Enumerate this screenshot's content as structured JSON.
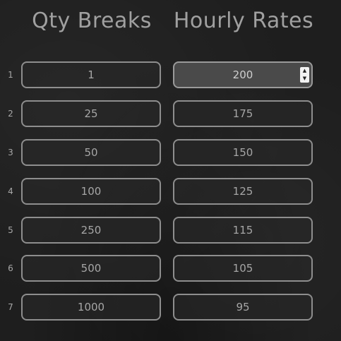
{
  "header": {
    "qty_title": "Qty Breaks",
    "rate_title": "Hourly Rates"
  },
  "rows": [
    {
      "num": "1",
      "qty": "1",
      "rate": "200"
    },
    {
      "num": "2",
      "qty": "25",
      "rate": "175"
    },
    {
      "num": "3",
      "qty": "50",
      "rate": "150"
    },
    {
      "num": "4",
      "qty": "100",
      "rate": "125"
    },
    {
      "num": "5",
      "qty": "250",
      "rate": "115"
    },
    {
      "num": "6",
      "qty": "500",
      "rate": "105"
    },
    {
      "num": "7",
      "qty": "1000",
      "rate": "95"
    }
  ],
  "spinner": {
    "up_icon": "▲",
    "down_icon": "▼"
  },
  "colors": {
    "background": "#1e1e1e",
    "border": "#8e8e8e",
    "text": "#a6a6a6",
    "active_field": "#4a4a4a"
  }
}
